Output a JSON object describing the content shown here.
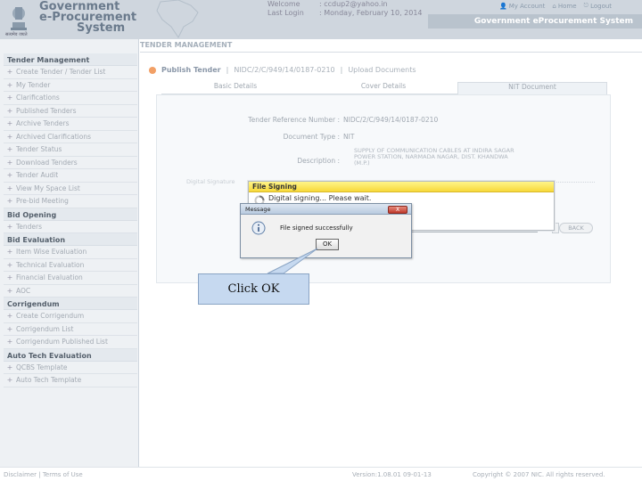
{
  "header": {
    "logo_line1": "Government",
    "logo_line2": "e-Procurement",
    "logo_line3": "System",
    "logo_caption": "सत्यमेव जयते",
    "welcome_label": "Welcome",
    "welcome_value": ": ccdup2@yahoo.in",
    "last_login_label": "Last Login",
    "last_login_value": ": Monday, February 10, 2014",
    "link_my_account": "My Account",
    "link_home": "Home",
    "link_logout": "Logout",
    "system_banner": "Government eProcurement System"
  },
  "sidebar": {
    "sections": [
      {
        "title": "Tender Management",
        "items": [
          "Create Tender / Tender List",
          "My Tender",
          "Clarifications",
          "Published Tenders",
          "Archive Tenders",
          "Archived Clarifications",
          "Tender Status",
          "Download Tenders",
          "Tender Audit",
          "View My Space List",
          "Pre-bid Meeting"
        ]
      },
      {
        "title": "Bid Opening",
        "items": [
          "Tenders"
        ]
      },
      {
        "title": "Bid Evaluation",
        "items": [
          "Item Wise Evaluation",
          "Technical Evaluation",
          "Financial Evaluation",
          "AOC"
        ]
      },
      {
        "title": "Corrigendum",
        "items": [
          "Create Corrigendum",
          "Corrigendum List",
          "Corrigendum Published List"
        ]
      },
      {
        "title": "Auto Tech Evaluation",
        "items": [
          "QCBS Template",
          "Auto Tech Template"
        ]
      }
    ]
  },
  "main": {
    "title": "TENDER MANAGEMENT",
    "breadcrumb": {
      "first": "Publish Tender",
      "sep": "|",
      "second": "NIDC/2/C/949/14/0187-0210",
      "third": "Upload Documents"
    },
    "tabs": [
      "Basic Details",
      "Cover Details",
      "NIT Document"
    ],
    "fields": {
      "ref_label": "Tender Reference Number :",
      "ref_value": "NIDC/2/C/949/14/0187-0210",
      "doctype_label": "Document Type :",
      "doctype_value": "NIT",
      "desc_label": "Description :",
      "desc_value": "SUPPLY OF COMMUNICATION CABLES AT INDIRA SAGAR POWER STATION, NARMADA NAGAR, DIST. KHANDWA (M.P.)",
      "faint_label": "Digital Signature"
    },
    "back_label": "BACK"
  },
  "file_signing": {
    "title": "File Signing",
    "body": "Digital signing... Please wait."
  },
  "message_dialog": {
    "title": "Message",
    "close_label": "X",
    "text": "File signed successfully",
    "ok_label": "OK"
  },
  "callout": {
    "text": "Click OK"
  },
  "footer": {
    "left": "Disclaimer  |  Terms of Use",
    "mid": "Version:1.08.01 09-01-13",
    "right": "Copyright © 2007 NIC. All rights reserved."
  }
}
